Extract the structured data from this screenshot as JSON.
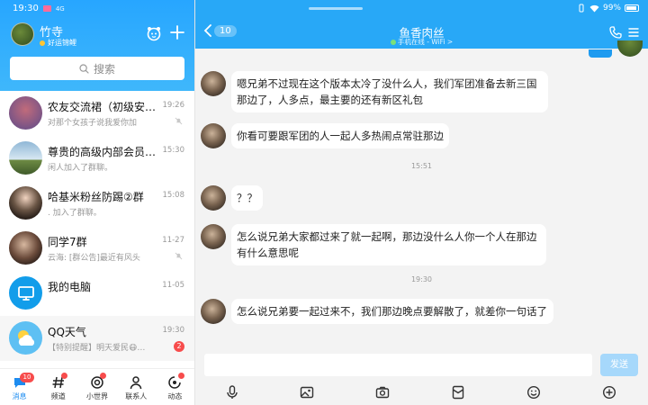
{
  "status_bar": {
    "time": "19:30",
    "icons_text": "4G",
    "battery": "99%"
  },
  "profile": {
    "name": "竹寺",
    "status": "好运锦鲤"
  },
  "search": {
    "placeholder": "搜索"
  },
  "conversations": [
    {
      "title": "农友交流裙（初级安…",
      "preview": "对那个女孩子说我爱你加",
      "time": "19:26",
      "muted": true,
      "badge": ""
    },
    {
      "title": "尊贵的高级内部会员…",
      "preview": "闲人加入了群聊。",
      "time": "15:30",
      "muted": false,
      "badge": ""
    },
    {
      "title": "哈基米粉丝防踢②群",
      "preview": ". 加入了群聊。",
      "time": "15:08",
      "muted": false,
      "badge": ""
    },
    {
      "title": "同学7群",
      "preview": "云海: [群公告]最近有风头",
      "time": "11-27",
      "muted": true,
      "badge": ""
    },
    {
      "title": "我的电脑",
      "preview": "",
      "time": "11-05",
      "muted": false,
      "badge": ""
    },
    {
      "title": "QQ天气",
      "preview": "【特别提醒】明天爱民😷…",
      "time": "19:30",
      "muted": false,
      "badge": "2"
    }
  ],
  "tabs": [
    {
      "label": "消息",
      "badge": "10",
      "active": true
    },
    {
      "label": "频道",
      "dot": true
    },
    {
      "label": "小世界",
      "dot": true
    },
    {
      "label": "联系人"
    },
    {
      "label": "动态",
      "dot": true
    }
  ],
  "chat": {
    "back_count": "10",
    "title": "鱼香肉丝",
    "subtitle": "手机在线 - WiFi >",
    "messages": [
      {
        "type": "msg",
        "text": "嗯兄弟不过现在这个版本太冷了没什么人，我们军团准备去新三国那边了，人多点，最主要的还有新区礼包"
      },
      {
        "type": "msg",
        "text": "你看可要跟军团的人一起人多热闹点常驻那边"
      },
      {
        "type": "time",
        "text": "15:51"
      },
      {
        "type": "msg",
        "text": "？？"
      },
      {
        "type": "msg",
        "text": "怎么说兄弟大家都过来了就一起啊，那边没什么人你一个人在那边有什么意思呢"
      },
      {
        "type": "time",
        "text": "19:30"
      },
      {
        "type": "msg",
        "text": "怎么说兄弟要一起过来不，我们那边晚点要解散了，就差你一句话了"
      }
    ],
    "send_label": "发送",
    "toolbar_icons": [
      "microphone-icon",
      "image-icon",
      "camera-icon",
      "red-packet-icon",
      "emoji-icon",
      "plus-icon"
    ]
  },
  "colors": {
    "brand": "#28a8f7",
    "badge": "#f74c4c",
    "send_disabled": "#a6d8fb"
  }
}
